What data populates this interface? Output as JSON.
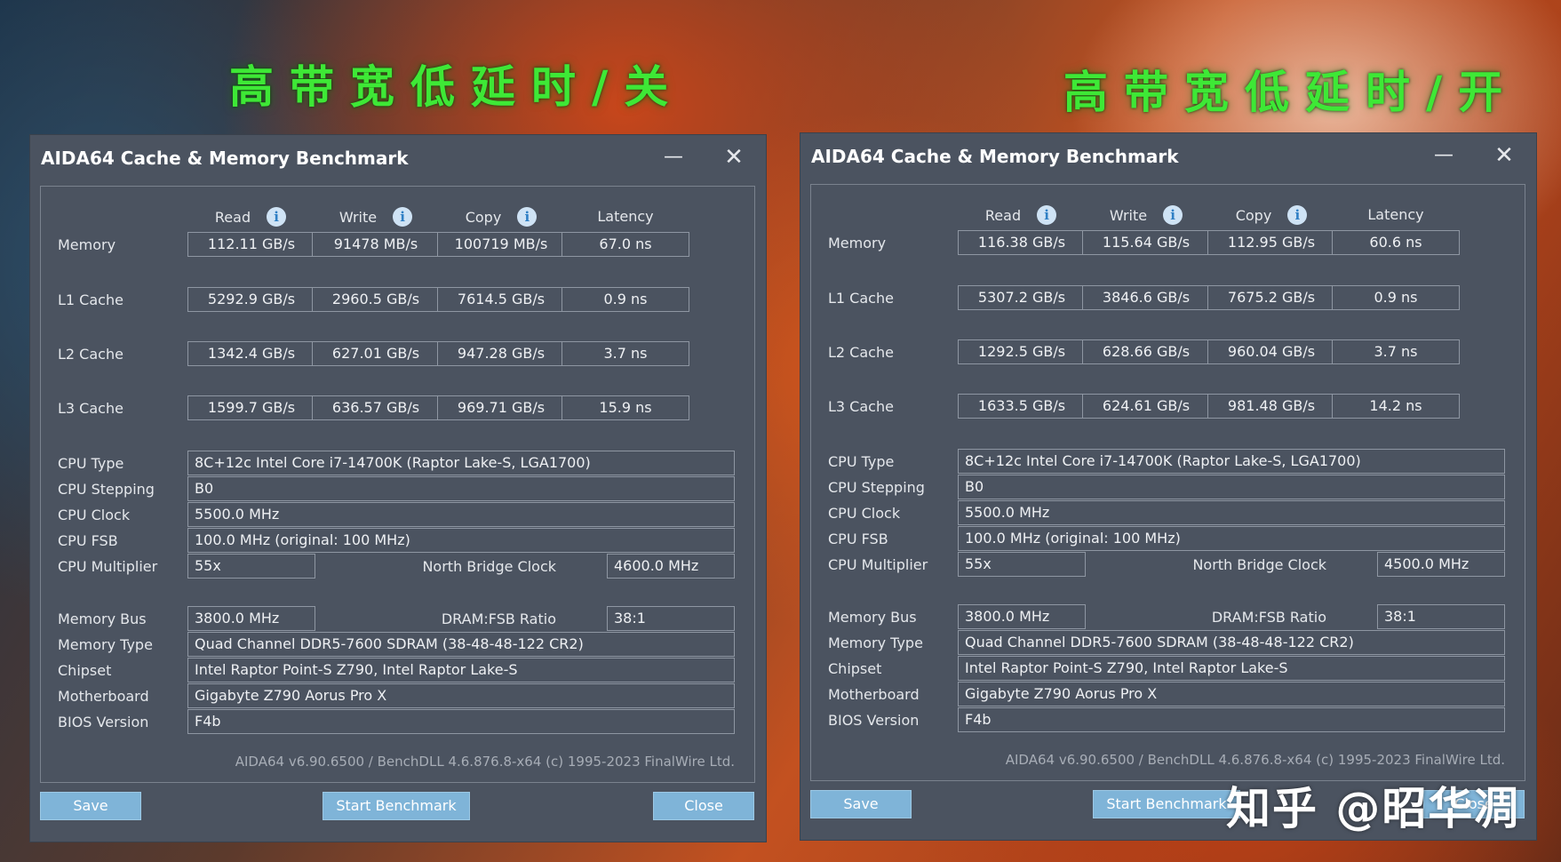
{
  "banner_left": "高带宽低延时/关",
  "banner_right": "高带宽低延时/开",
  "watermark": "知乎 @昭华凋",
  "columns": {
    "read": "Read",
    "write": "Write",
    "copy": "Copy",
    "latency": "Latency"
  },
  "row_labels": {
    "memory": "Memory",
    "l1": "L1 Cache",
    "l2": "L2 Cache",
    "l3": "L3 Cache",
    "cpu_type": "CPU Type",
    "cpu_stepping": "CPU Stepping",
    "cpu_clock": "CPU Clock",
    "cpu_fsb": "CPU FSB",
    "cpu_multiplier": "CPU Multiplier",
    "nb_clock": "North Bridge Clock",
    "memory_bus": "Memory Bus",
    "dram_fsb": "DRAM:FSB Ratio",
    "memory_type": "Memory Type",
    "chipset": "Chipset",
    "motherboard": "Motherboard",
    "bios": "BIOS Version"
  },
  "buttons": {
    "save": "Save",
    "start": "Start Benchmark",
    "close": "Close"
  },
  "windows": [
    {
      "title": "AIDA64 Cache & Memory Benchmark",
      "results": {
        "memory": [
          "112.11 GB/s",
          "91478 MB/s",
          "100719 MB/s",
          "67.0 ns"
        ],
        "l1": [
          "5292.9 GB/s",
          "2960.5 GB/s",
          "7614.5 GB/s",
          "0.9 ns"
        ],
        "l2": [
          "1342.4 GB/s",
          "627.01 GB/s",
          "947.28 GB/s",
          "3.7 ns"
        ],
        "l3": [
          "1599.7 GB/s",
          "636.57 GB/s",
          "969.71 GB/s",
          "15.9 ns"
        ]
      },
      "info": {
        "cpu_type": "8C+12c Intel Core i7-14700K  (Raptor Lake-S, LGA1700)",
        "cpu_stepping": "B0",
        "cpu_clock": "5500.0 MHz",
        "cpu_fsb": "100.0 MHz  (original: 100 MHz)",
        "cpu_multiplier": "55x",
        "nb_clock": "4600.0 MHz",
        "memory_bus": "3800.0 MHz",
        "dram_fsb": "38:1",
        "memory_type": "Quad Channel DDR5-7600 SDRAM  (38-48-48-122 CR2)",
        "chipset": "Intel Raptor Point-S Z790, Intel Raptor Lake-S",
        "motherboard": "Gigabyte Z790 Aorus Pro X",
        "bios": "F4b"
      },
      "footer": "AIDA64 v6.90.6500 / BenchDLL 4.6.876.8-x64  (c) 1995-2023 FinalWire Ltd."
    },
    {
      "title": "AIDA64 Cache & Memory Benchmark",
      "results": {
        "memory": [
          "116.38 GB/s",
          "115.64 GB/s",
          "112.95 GB/s",
          "60.6 ns"
        ],
        "l1": [
          "5307.2 GB/s",
          "3846.6 GB/s",
          "7675.2 GB/s",
          "0.9 ns"
        ],
        "l2": [
          "1292.5 GB/s",
          "628.66 GB/s",
          "960.04 GB/s",
          "3.7 ns"
        ],
        "l3": [
          "1633.5 GB/s",
          "624.61 GB/s",
          "981.48 GB/s",
          "14.2 ns"
        ]
      },
      "info": {
        "cpu_type": "8C+12c Intel Core i7-14700K  (Raptor Lake-S, LGA1700)",
        "cpu_stepping": "B0",
        "cpu_clock": "5500.0 MHz",
        "cpu_fsb": "100.0 MHz  (original: 100 MHz)",
        "cpu_multiplier": "55x",
        "nb_clock": "4500.0 MHz",
        "memory_bus": "3800.0 MHz",
        "dram_fsb": "38:1",
        "memory_type": "Quad Channel DDR5-7600 SDRAM  (38-48-48-122 CR2)",
        "chipset": "Intel Raptor Point-S Z790, Intel Raptor Lake-S",
        "motherboard": "Gigabyte Z790 Aorus Pro X",
        "bios": "F4b"
      },
      "footer": "AIDA64 v6.90.6500 / BenchDLL 4.6.876.8-x64  (c) 1995-2023 FinalWire Ltd."
    }
  ]
}
